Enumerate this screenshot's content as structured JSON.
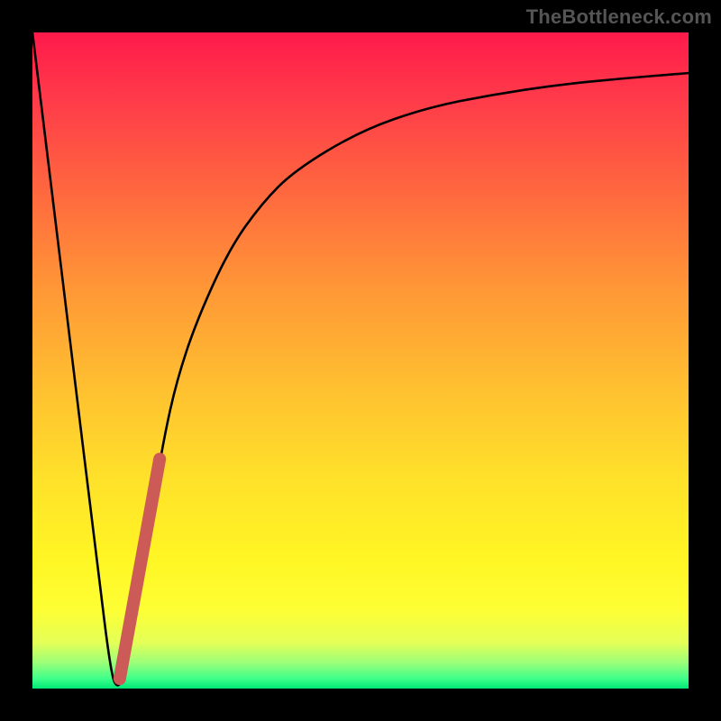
{
  "watermark": "TheBottleneck.com",
  "chart_data": {
    "type": "line",
    "title": "",
    "xlabel": "",
    "ylabel": "",
    "xlim": [
      0,
      100
    ],
    "ylim": [
      0,
      100
    ],
    "grid": false,
    "legend": false,
    "series": [
      {
        "name": "bottleneck-curve",
        "x": [
          0,
          5,
          10,
          12,
          13,
          14,
          16,
          18,
          20,
          22,
          25,
          30,
          35,
          40,
          50,
          60,
          70,
          80,
          90,
          100
        ],
        "y": [
          100,
          59,
          18,
          2,
          0,
          2,
          13,
          26,
          38,
          47,
          56,
          67,
          74,
          79,
          85,
          88.5,
          90.5,
          92,
          93,
          93.8
        ]
      },
      {
        "name": "current-range-marker",
        "x": [
          13.3,
          19.4
        ],
        "y": [
          1.5,
          35
        ]
      }
    ],
    "gradient_stops": [
      {
        "pos": 0,
        "color": "#ff1a4b"
      },
      {
        "pos": 0.55,
        "color": "#ffc230"
      },
      {
        "pos": 0.88,
        "color": "#fdff34"
      },
      {
        "pos": 1.0,
        "color": "#00e676"
      }
    ]
  }
}
